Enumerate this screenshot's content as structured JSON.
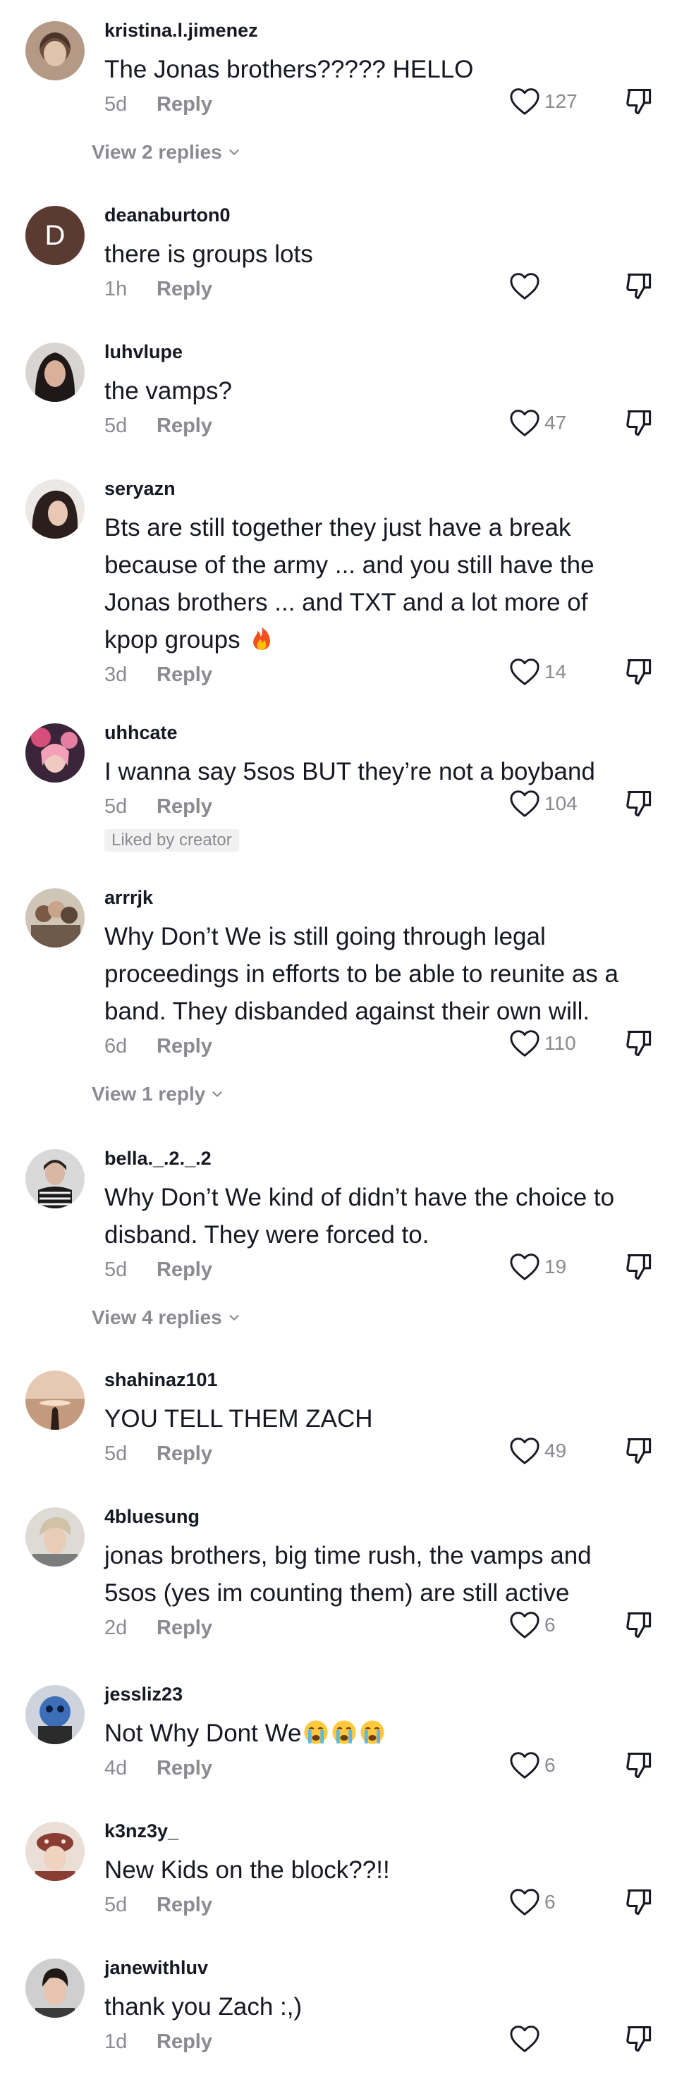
{
  "comments": [
    {
      "username": "kristina.l.jimenez",
      "text": "The Jonas brothers????? HELLO",
      "time": "5d",
      "reply_label": "Reply",
      "likes": "127",
      "view_replies": "View 2 replies",
      "avatar_color": "#8a6d5c"
    },
    {
      "username": "deanaburton0",
      "text": "there is groups lots",
      "time": "1h",
      "reply_label": "Reply",
      "likes": "",
      "avatar_letter": "D",
      "avatar_color": "#5b3a31"
    },
    {
      "username": "luhvlupe",
      "text": "the vamps?",
      "time": "5d",
      "reply_label": "Reply",
      "likes": "47",
      "avatar_color": "#2d2524"
    },
    {
      "username": "seryazn",
      "text": "Bts are still together they just have a break because of the army ... and you still have the Jonas brothers ... and TXT and a lot more of kpop groups",
      "time": "3d",
      "reply_label": "Reply",
      "likes": "14",
      "emoji": "fire-emoji",
      "avatar_color": "#3b2f2c"
    },
    {
      "username": "uhhcate",
      "text": "I wanna say 5sos BUT they’re not a boyband",
      "time": "5d",
      "reply_label": "Reply",
      "likes": "104",
      "badge": "Liked by creator",
      "avatar_color": "#c2586f"
    },
    {
      "username": "arrrjk",
      "text": "Why Don’t We is still going through legal proceedings in efforts to be able to reunite as a band. They disbanded against their own will.",
      "time": "6d",
      "reply_label": "Reply",
      "likes": "110",
      "view_replies": "View 1 reply",
      "avatar_color": "#7a6a5a"
    },
    {
      "username": "bella._.2._.2",
      "text": "Why Don’t We kind of didn’t have the choice to disband. They were forced to.",
      "time": "5d",
      "reply_label": "Reply",
      "likes": "19",
      "view_replies": "View 4 replies",
      "avatar_color": "#6d6d6d"
    },
    {
      "username": "shahinaz101",
      "text": "YOU TELL THEM ZACH",
      "time": "5d",
      "reply_label": "Reply",
      "likes": "49",
      "avatar_color": "#c7a083"
    },
    {
      "username": "4bluesung",
      "text": "jonas brothers, big time rush, the vamps and 5sos (yes im counting them) are still active",
      "time": "2d",
      "reply_label": "Reply",
      "likes": "6",
      "avatar_color": "#b5aa9a"
    },
    {
      "username": "jessliz23",
      "text": "Not Why Dont We",
      "time": "4d",
      "reply_label": "Reply",
      "likes": "6",
      "emoji": "crying-emoji",
      "avatar_color": "#3d6fb8"
    },
    {
      "username": "k3nz3y_",
      "text": "New Kids on the block??!!",
      "time": "5d",
      "reply_label": "Reply",
      "likes": "6",
      "avatar_color": "#8a3d32"
    },
    {
      "username": "janewithluv",
      "text": "thank you Zach :,)",
      "time": "1d",
      "reply_label": "Reply",
      "likes": "",
      "avatar_color": "#3a3a3a"
    }
  ]
}
